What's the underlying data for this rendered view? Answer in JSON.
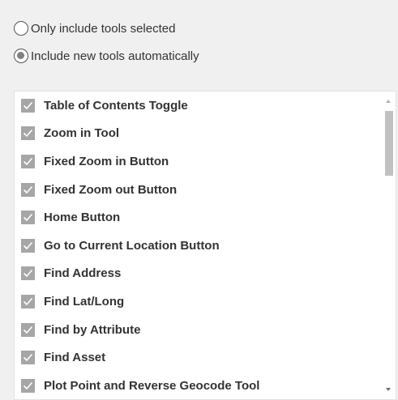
{
  "mode": {
    "options": [
      {
        "label": "Only include tools selected",
        "checked": false
      },
      {
        "label": "Include new tools automatically",
        "checked": true
      }
    ]
  },
  "tools": [
    {
      "label": "Table of Contents Toggle",
      "checked": true
    },
    {
      "label": "Zoom in Tool",
      "checked": true
    },
    {
      "label": "Fixed Zoom in Button",
      "checked": true
    },
    {
      "label": "Fixed Zoom out Button",
      "checked": true
    },
    {
      "label": "Home Button",
      "checked": true
    },
    {
      "label": "Go to Current Location Button",
      "checked": true
    },
    {
      "label": "Find Address",
      "checked": true
    },
    {
      "label": "Find Lat/Long",
      "checked": true
    },
    {
      "label": "Find by Attribute",
      "checked": true
    },
    {
      "label": "Find Asset",
      "checked": true
    },
    {
      "label": "Plot Point and Reverse Geocode Tool",
      "checked": true
    }
  ],
  "colors": {
    "checkbox_fill": "#a6a6a6",
    "background": "#f0f0f0",
    "list_background": "#ffffff"
  }
}
